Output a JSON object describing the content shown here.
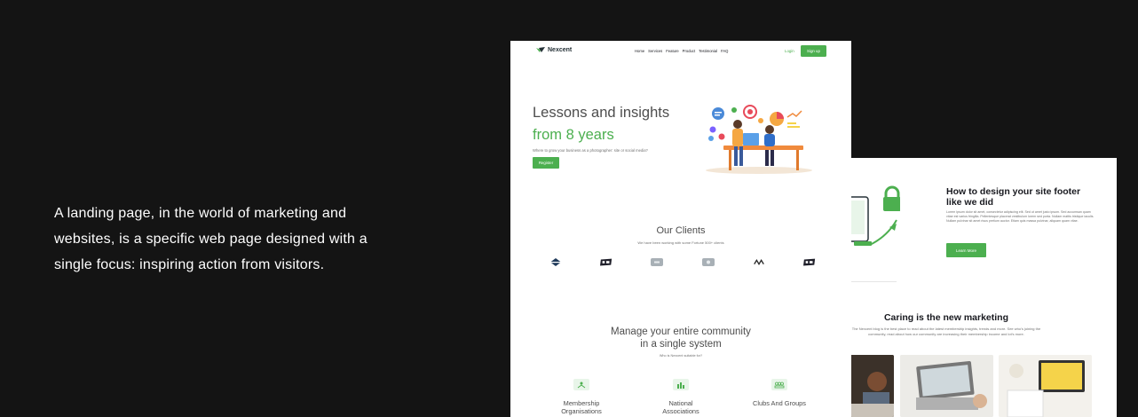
{
  "intro": {
    "text": "A landing page, in the world of marketing and websites, is a specific web page designed with a single focus: inspiring action from visitors."
  },
  "colors": {
    "accent": "#4CAF4F",
    "background": "#141414",
    "heading": "#4D4D4D",
    "muted": "#717171"
  },
  "nav": {
    "logo_text": "Nexcent",
    "items": [
      "Home",
      "Services",
      "Feature",
      "Product",
      "Testimonial",
      "FAQ"
    ],
    "login": "Login",
    "signup": "Sign up"
  },
  "hero": {
    "line1": "Lessons and insights",
    "line2": "from 8 years",
    "subtitle": "Where to grow your business as a photographer: site or social media?",
    "button": "Register"
  },
  "clients": {
    "title": "Our Clients",
    "subtitle": "We have been working with some Fortune 500+ clients",
    "logos": [
      "logo-1-icon",
      "logo-2-icon",
      "logo-3-icon",
      "logo-4-icon",
      "logo-5-icon",
      "logo-6-icon"
    ]
  },
  "manage": {
    "line1": "Manage your entire community",
    "line2": "in a single system",
    "subtitle": "Who is Nexcent suitable for?",
    "features": [
      {
        "label": "Membership Organisations",
        "icon": "membership-icon"
      },
      {
        "label": "National Associations",
        "icon": "building-icon"
      },
      {
        "label": "Clubs And Groups",
        "icon": "group-icon"
      }
    ]
  },
  "blog": {
    "title": "How to design your site footer like we did",
    "text": "Lorem ipsum dolor sit amet, consectetur adipiscing elit. Sed ut amet justo ipsum. Sed accumsan quam vitae est varius fringilla. Pellentesque placerat vestibulum lorem sed porta. Nullam mattis tristique iaculis. Nullam pulvinar sit amet risus pretium auctor. Etiam quis massa pulvinar, aliquam quam vitae.",
    "button": "Learn More",
    "section_title": "Caring is the new marketing",
    "section_text": "The Nexcent blog is the best place to read about the latest membership insights, trends and more. See who's joining the community, read about how our community are increasing their membership income and lot's more."
  }
}
